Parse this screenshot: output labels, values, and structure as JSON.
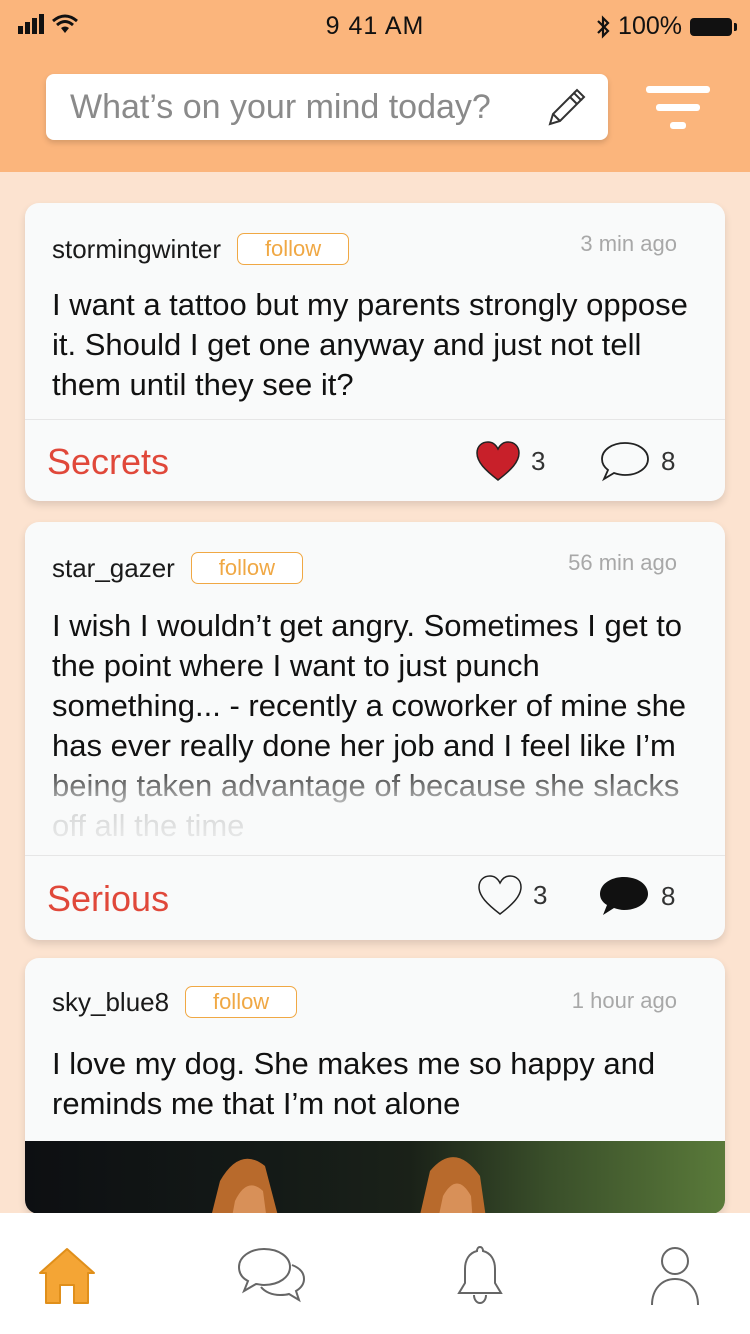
{
  "status_bar": {
    "time": "9 41 AM",
    "battery": "100%"
  },
  "search": {
    "placeholder": "What’s on your mind today?"
  },
  "posts": [
    {
      "username": "stormingwinter",
      "follow_label": "follow",
      "time_ago": "3 min ago",
      "text": "I want a tattoo but my parents strongly oppose it. Should I get one anyway and just not tell them until they see it?",
      "category": "Secrets",
      "likes": "3",
      "comments": "8",
      "liked": true,
      "commented": false
    },
    {
      "username": "star_gazer",
      "follow_label": "follow",
      "time_ago": "56 min ago",
      "text": "I wish I wouldn’t get angry. Sometimes I get to the point where I want to just punch something... - recently a coworker of mine she has ever really done her job and I feel like I’m being taken advantage of because she slacks off all the time",
      "category": "Serious",
      "likes": "3",
      "comments": "8",
      "liked": false,
      "commented": true
    },
    {
      "username": "sky_blue8",
      "follow_label": "follow",
      "time_ago": "1 hour ago",
      "text": "I love my dog. She makes me so happy and reminds me that I’m not alone"
    }
  ],
  "tabs": [
    {
      "icon": "home-icon",
      "active": true
    },
    {
      "icon": "chat-icon",
      "active": false
    },
    {
      "icon": "bell-icon",
      "active": false
    },
    {
      "icon": "profile-icon",
      "active": false
    }
  ],
  "colors": {
    "header": "#fbb57c",
    "background": "#fce3d0",
    "category": "#e0483a",
    "follow": "#f0a844",
    "heart_filled": "#c8202a",
    "tab_active": "#f4a535"
  }
}
